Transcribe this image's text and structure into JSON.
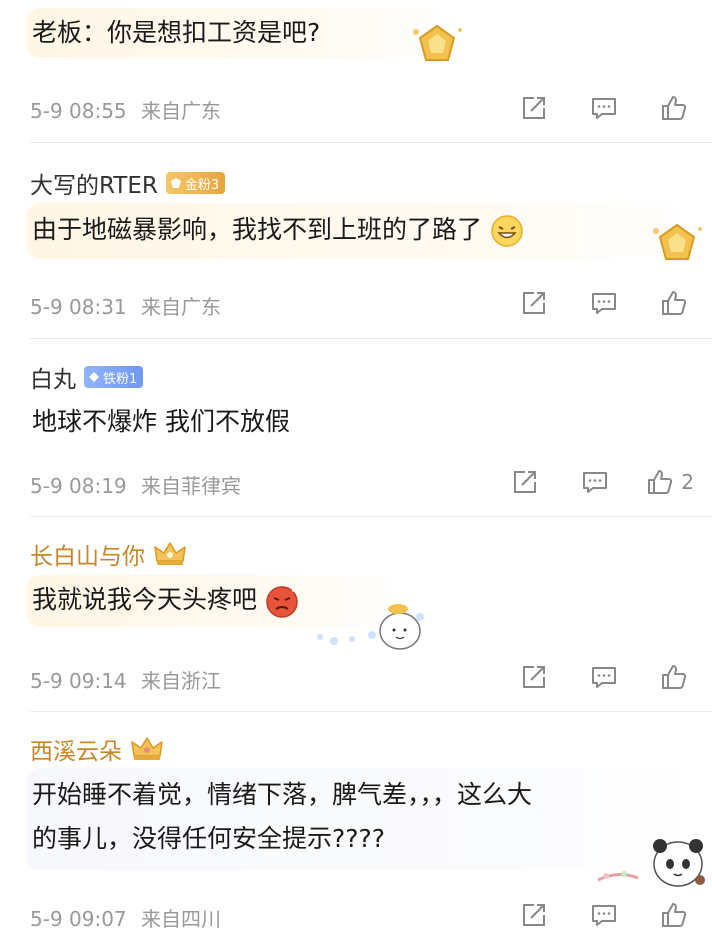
{
  "comments": [
    {
      "username": "",
      "badge": "",
      "text": "老板：你是想扣工资是吧?",
      "time": "5-9 08:55",
      "location": "来自广东",
      "likes": ""
    },
    {
      "username": "大写的RTER",
      "badge": "金粉3",
      "text": "由于地磁暴影响，我找不到上班的了路了",
      "time": "5-9 08:31",
      "location": "来自广东",
      "likes": ""
    },
    {
      "username": "白丸",
      "badge": "铁粉1",
      "text": "地球不爆炸 我们不放假",
      "time": "5-9 08:19",
      "location": "来自菲律宾",
      "likes": "2"
    },
    {
      "username": "长白山与你",
      "badge": "",
      "text": "我就说我今天头疼吧",
      "time": "5-9 09:14",
      "location": "来自浙江",
      "likes": ""
    },
    {
      "username": "西溪云朵",
      "badge": "",
      "text_line1": "开始睡不着觉，情绪下落，脾气差，，，这么大",
      "text_line2": "的事儿，没得任何安全提示????",
      "time": "5-9 09:07",
      "location": "来自四川",
      "likes": ""
    }
  ],
  "colors": {
    "username": "#333333",
    "vip_username": "#c8862a",
    "meta": "#999999",
    "gold_badge": "#e6a53d",
    "blue_badge": "#6f97f6"
  },
  "icons": [
    "share-icon",
    "comment-icon",
    "like-icon",
    "crown-icon",
    "gem-icon"
  ]
}
